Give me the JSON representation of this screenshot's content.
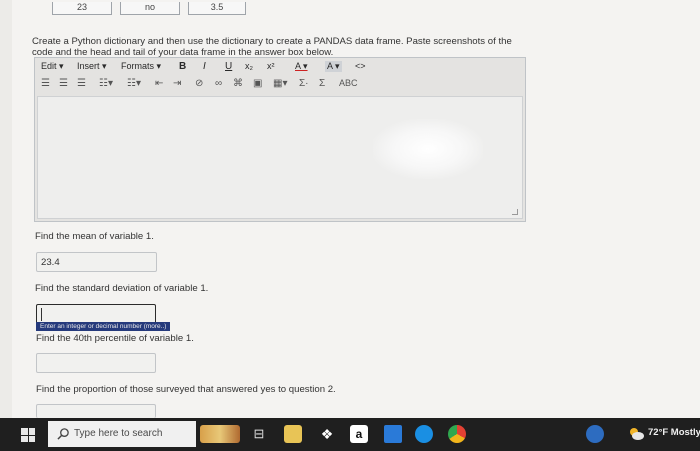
{
  "top_table": {
    "cells": [
      "23",
      "no",
      "3.5"
    ]
  },
  "instructions": "Create a Python dictionary and then use the dictionary to create a PANDAS data frame. Paste screenshots of the code and the head and tail of your data frame in the answer box below.",
  "editor": {
    "menu": {
      "edit": "Edit",
      "insert": "Insert",
      "formats": "Formats",
      "bold": "B",
      "italic": "I",
      "underline": "U",
      "subscript": "x₂",
      "superscript": "x²",
      "text_color": "A",
      "bg_color": "A",
      "source": "<>"
    },
    "toolbar2": {
      "sigma_sub": "Σ·",
      "sigma": "Σ",
      "spell": "ABC"
    }
  },
  "questions": [
    {
      "label": "Find the mean of variable 1.",
      "answer": "23.4"
    },
    {
      "label": "Find the standard deviation of variable 1.",
      "answer": "",
      "tooltip": "Enter an integer or decimal number (more..)"
    },
    {
      "label": "Find the 40th percentile of variable 1.",
      "answer": ""
    },
    {
      "label": "Find the proportion of those surveyed that answered yes to question 2.",
      "answer": ""
    }
  ],
  "taskbar": {
    "search_placeholder": "Type here to search",
    "weather": "72°F Mostly",
    "colors": {
      "bar": "#1f1f1f",
      "edge": "#2f7de1",
      "dropbox": "#ffffff",
      "mail": "#2a7ad8",
      "chrome": "#f2b51b"
    }
  }
}
